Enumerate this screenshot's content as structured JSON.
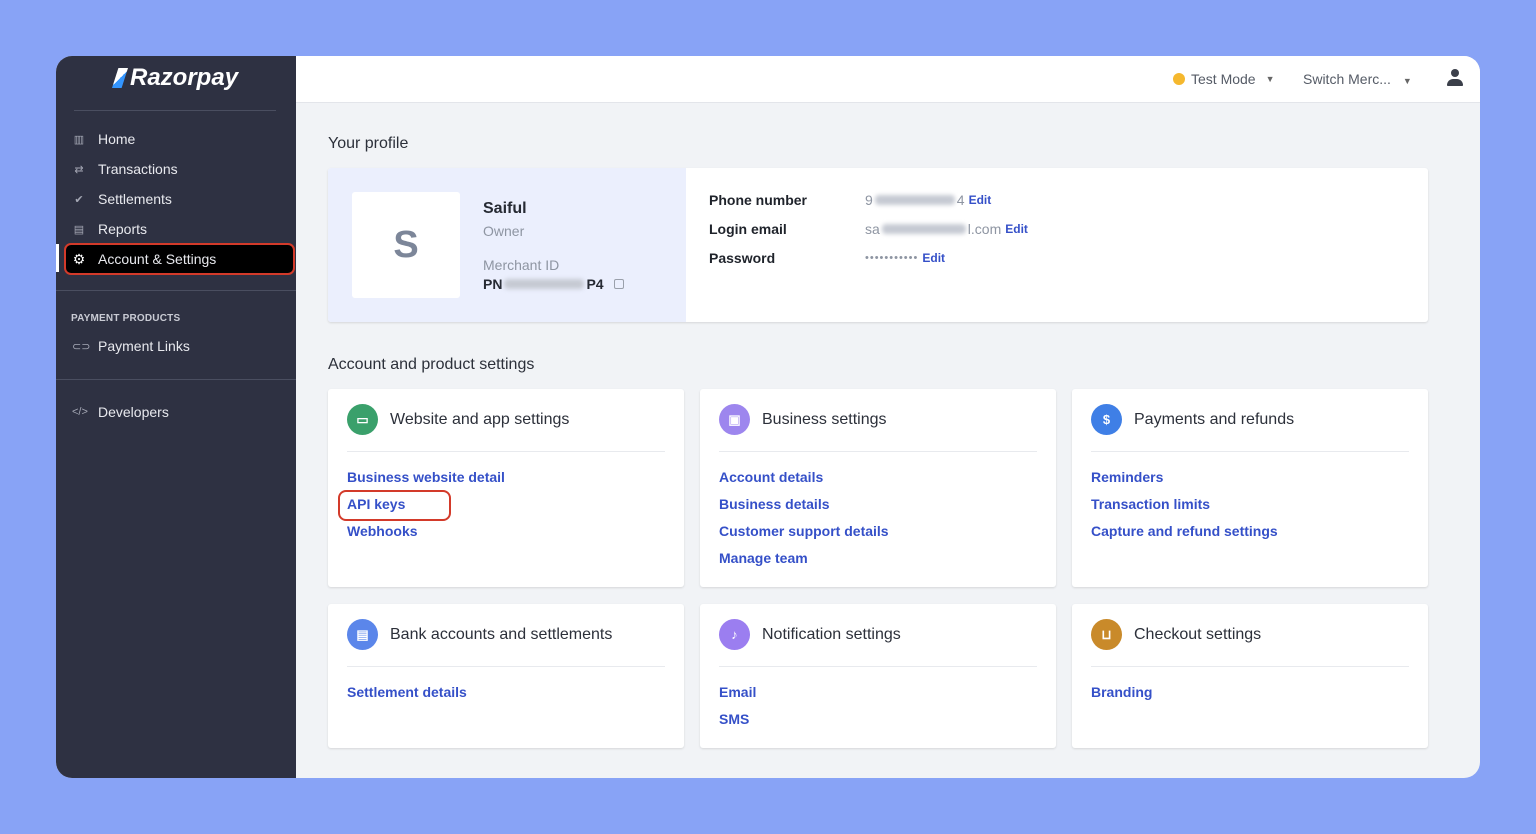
{
  "brand": "Razorpay",
  "sidebar": {
    "items": [
      {
        "label": "Home",
        "icon": "chart-icon"
      },
      {
        "label": "Transactions",
        "icon": "swap-icon"
      },
      {
        "label": "Settlements",
        "icon": "double-check-icon"
      },
      {
        "label": "Reports",
        "icon": "report-icon"
      },
      {
        "label": "Account & Settings",
        "icon": "gear-icon"
      }
    ],
    "section": "PAYMENT PRODUCTS",
    "products": [
      {
        "label": "Payment Links"
      }
    ],
    "developers": "Developers"
  },
  "topbar": {
    "mode": "Test Mode",
    "switch": "Switch Merc..."
  },
  "profile": {
    "heading": "Your profile",
    "initial": "S",
    "name": "Saiful",
    "role": "Owner",
    "merchant_label": "Merchant ID",
    "merchant_prefix": "PN",
    "merchant_suffix": "P4",
    "fields": [
      {
        "label": "Phone number",
        "prefix": "9",
        "suffix": "4"
      },
      {
        "label": "Login email",
        "prefix": "sa",
        "suffix": "l.com"
      },
      {
        "label": "Password",
        "prefix": "•••••••••••",
        "suffix": ""
      }
    ],
    "edit": "Edit"
  },
  "settings": {
    "heading": "Account and product settings",
    "cards": [
      {
        "title": "Website and app settings",
        "color": "#3aa06b",
        "links": [
          "Business website detail",
          "API keys",
          "Webhooks"
        ]
      },
      {
        "title": "Business settings",
        "color": "#9d86ee",
        "links": [
          "Account details",
          "Business details",
          "Customer support details",
          "Manage team"
        ]
      },
      {
        "title": "Payments and refunds",
        "color": "#3f7fe6",
        "links": [
          "Reminders",
          "Transaction limits",
          "Capture and refund settings"
        ]
      },
      {
        "title": "Bank accounts and settlements",
        "color": "#5b86ea",
        "links": [
          "Settlement details"
        ]
      },
      {
        "title": "Notification settings",
        "color": "#9b7ef0",
        "links": [
          "Email",
          "SMS"
        ]
      },
      {
        "title": "Checkout settings",
        "color": "#c98a2a",
        "links": [
          "Branding"
        ]
      }
    ]
  }
}
